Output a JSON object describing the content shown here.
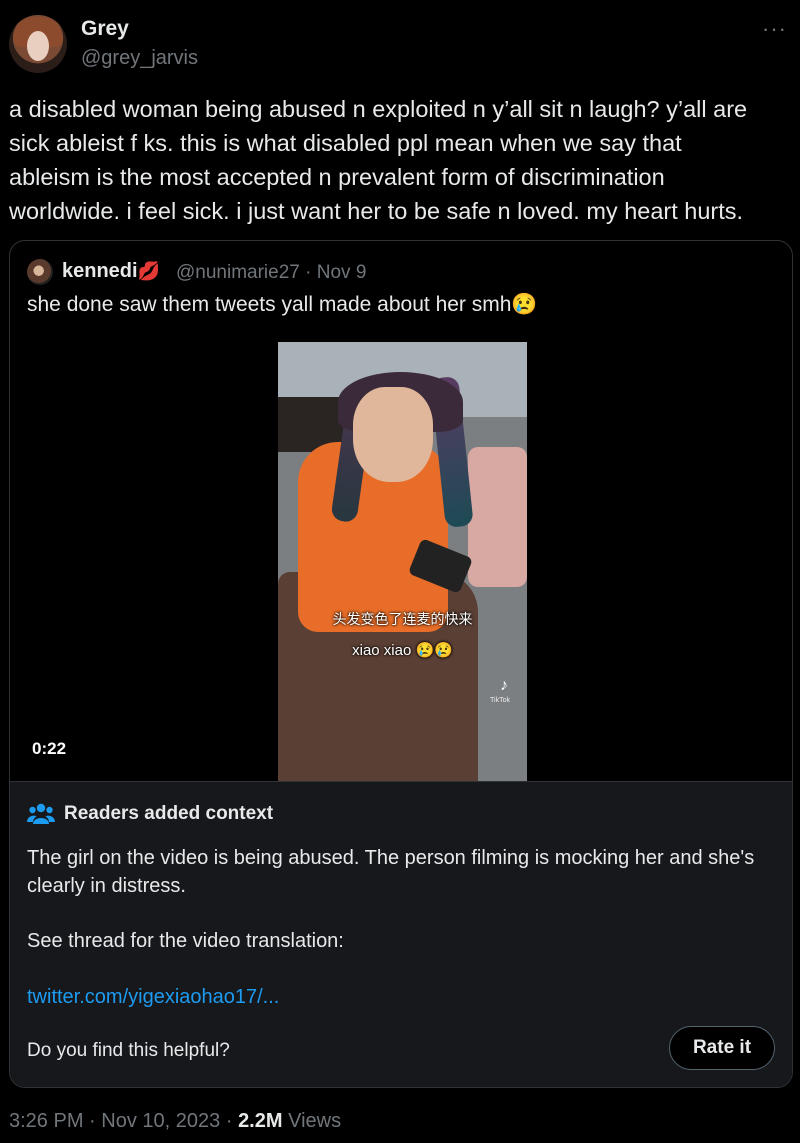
{
  "post": {
    "author_name": "Grey",
    "author_handle": "@grey_jarvis",
    "more_glyph": "···",
    "text": "a disabled woman being abused n exploited n y’all sit n laugh? y’all are\nsick ableist f     ks. this is what disabled ppl mean when we say that\nableism is the most accepted n prevalent form of discrimination\nworldwide. i feel sick. i just want her to be safe n loved. my heart hurts."
  },
  "quoted": {
    "author_name": "kennedi",
    "name_emoji": "💋",
    "author_handle": "@nunimarie27",
    "date": "Nov 9",
    "text": "she done saw them tweets yall made about her smh😢",
    "video": {
      "caption_line1": "头发变色了连麦的快来",
      "caption_line2": "xiao xiao 😢😢",
      "tiktok_label": "TikTok",
      "duration": "0:22"
    }
  },
  "context_note": {
    "title": "Readers added context",
    "body": "The girl on the video is being abused. The person filming is mocking her and she's clearly in distress.",
    "thread_line": "See thread for the video translation:",
    "link": "twitter.com/yigexiaohao17/...",
    "question": "Do you find this helpful?",
    "rate_label": "Rate it"
  },
  "footer": {
    "time": "3:26 PM",
    "date": "Nov 10, 2023",
    "views_count": "2.2M",
    "views_label": "Views",
    "separator": "·"
  },
  "colors": {
    "background": "#000000",
    "text": "#e7e9ea",
    "muted": "#71767b",
    "link": "#1d9bf0",
    "note_background": "#16181c"
  }
}
